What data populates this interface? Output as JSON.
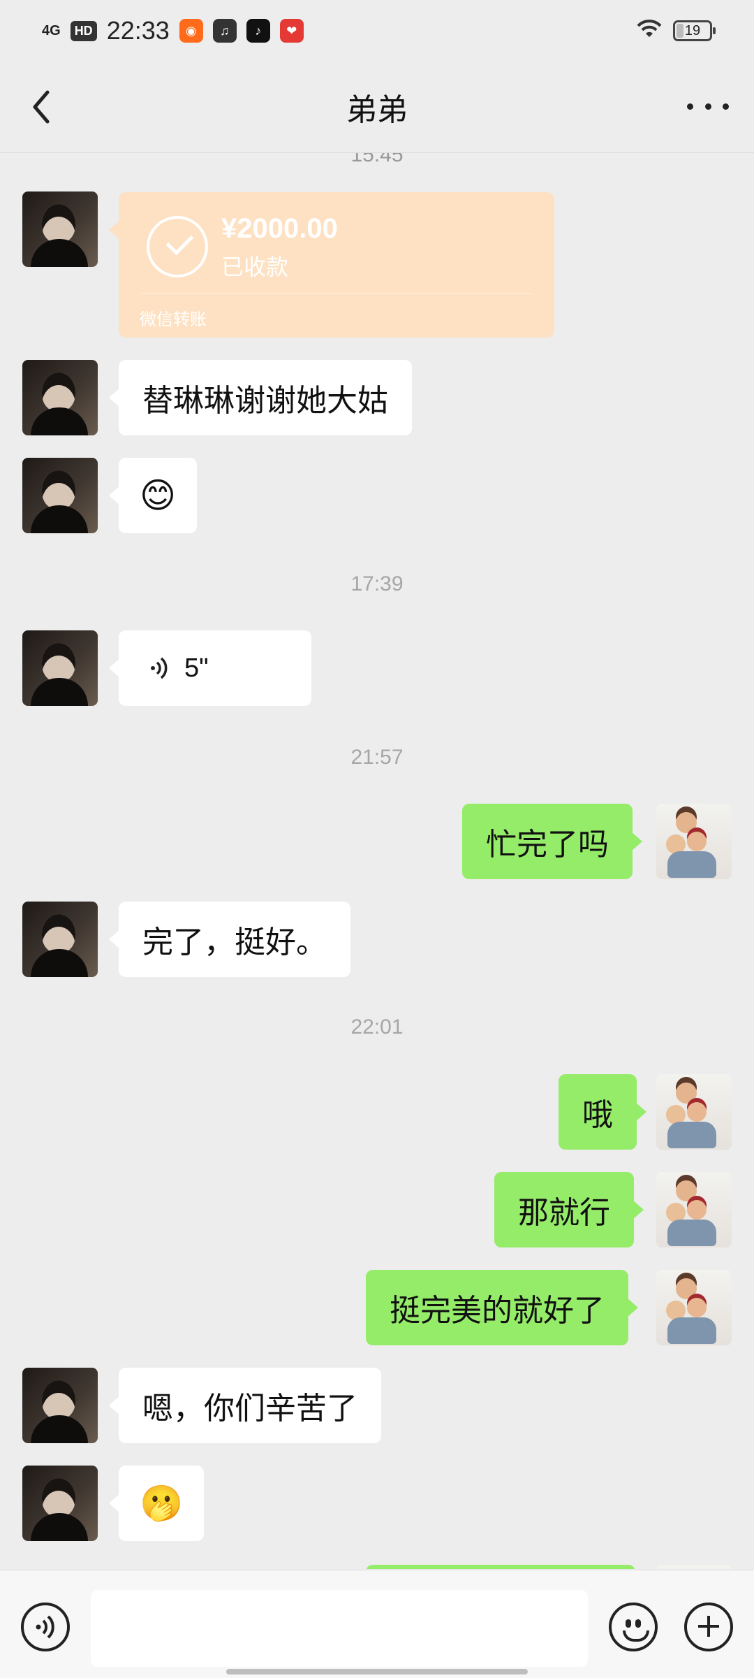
{
  "status_bar": {
    "time": "22:33",
    "network": "4G",
    "hd": "HD",
    "battery": "19"
  },
  "header": {
    "title": "弟弟"
  },
  "messages": {
    "top_time_partial": "15:45",
    "transfer": {
      "amount": "¥2000.00",
      "status": "已收款",
      "label": "微信转账"
    },
    "m1": "替琳琳谢谢她大姑",
    "m2_emoji": "😊",
    "t1": "17:39",
    "voice": "5\"",
    "t2": "21:57",
    "m3": "忙完了吗",
    "m4": "完了，挺好。",
    "t3": "22:01",
    "m5": "哦",
    "m6": "那就行",
    "m7": "挺完美的就好了",
    "m8": "嗯，你们辛苦了",
    "m9_emoji": "🫢"
  },
  "input": {
    "placeholder": ""
  }
}
